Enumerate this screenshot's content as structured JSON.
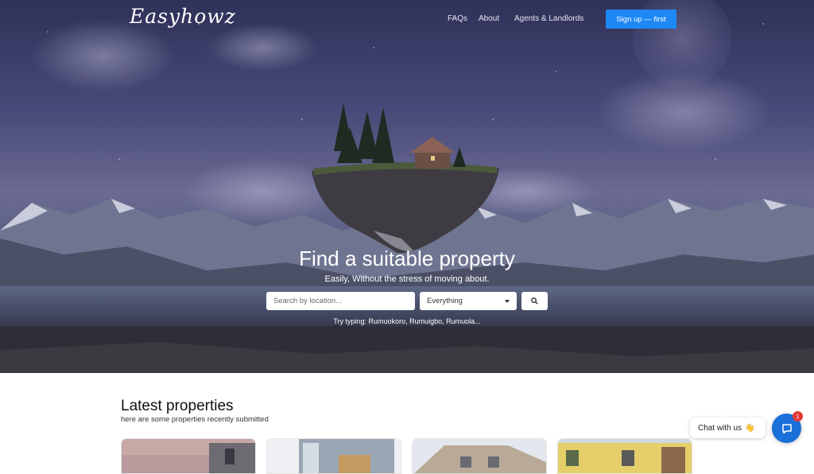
{
  "brand": {
    "logo": "Easyhowz"
  },
  "nav": {
    "items": [
      "FAQs",
      "About",
      "Agents & Landlords"
    ],
    "signup_label": "Sign up — first"
  },
  "hero": {
    "title": "Find a suitable property",
    "subtitle": "Easily, Without the stress of moving about.",
    "search_placeholder": "Search by location...",
    "filter_selected": "Everything",
    "hint": "Try typing: Rumuokoro, Rumuigbo, Rumuola..."
  },
  "latest": {
    "title": "Latest properties",
    "subtitle": "here are some properties recently submitted",
    "cards": [
      {
        "palette": "dusk-building"
      },
      {
        "palette": "white-building"
      },
      {
        "palette": "cream-building"
      },
      {
        "palette": "yellow-building"
      }
    ]
  },
  "chat": {
    "label": "Chat with us",
    "emoji": "👋",
    "badge_count": "1"
  },
  "colors": {
    "accent": "#1e88f5",
    "chat_button": "#1a6fd8",
    "badge": "#e53935"
  }
}
